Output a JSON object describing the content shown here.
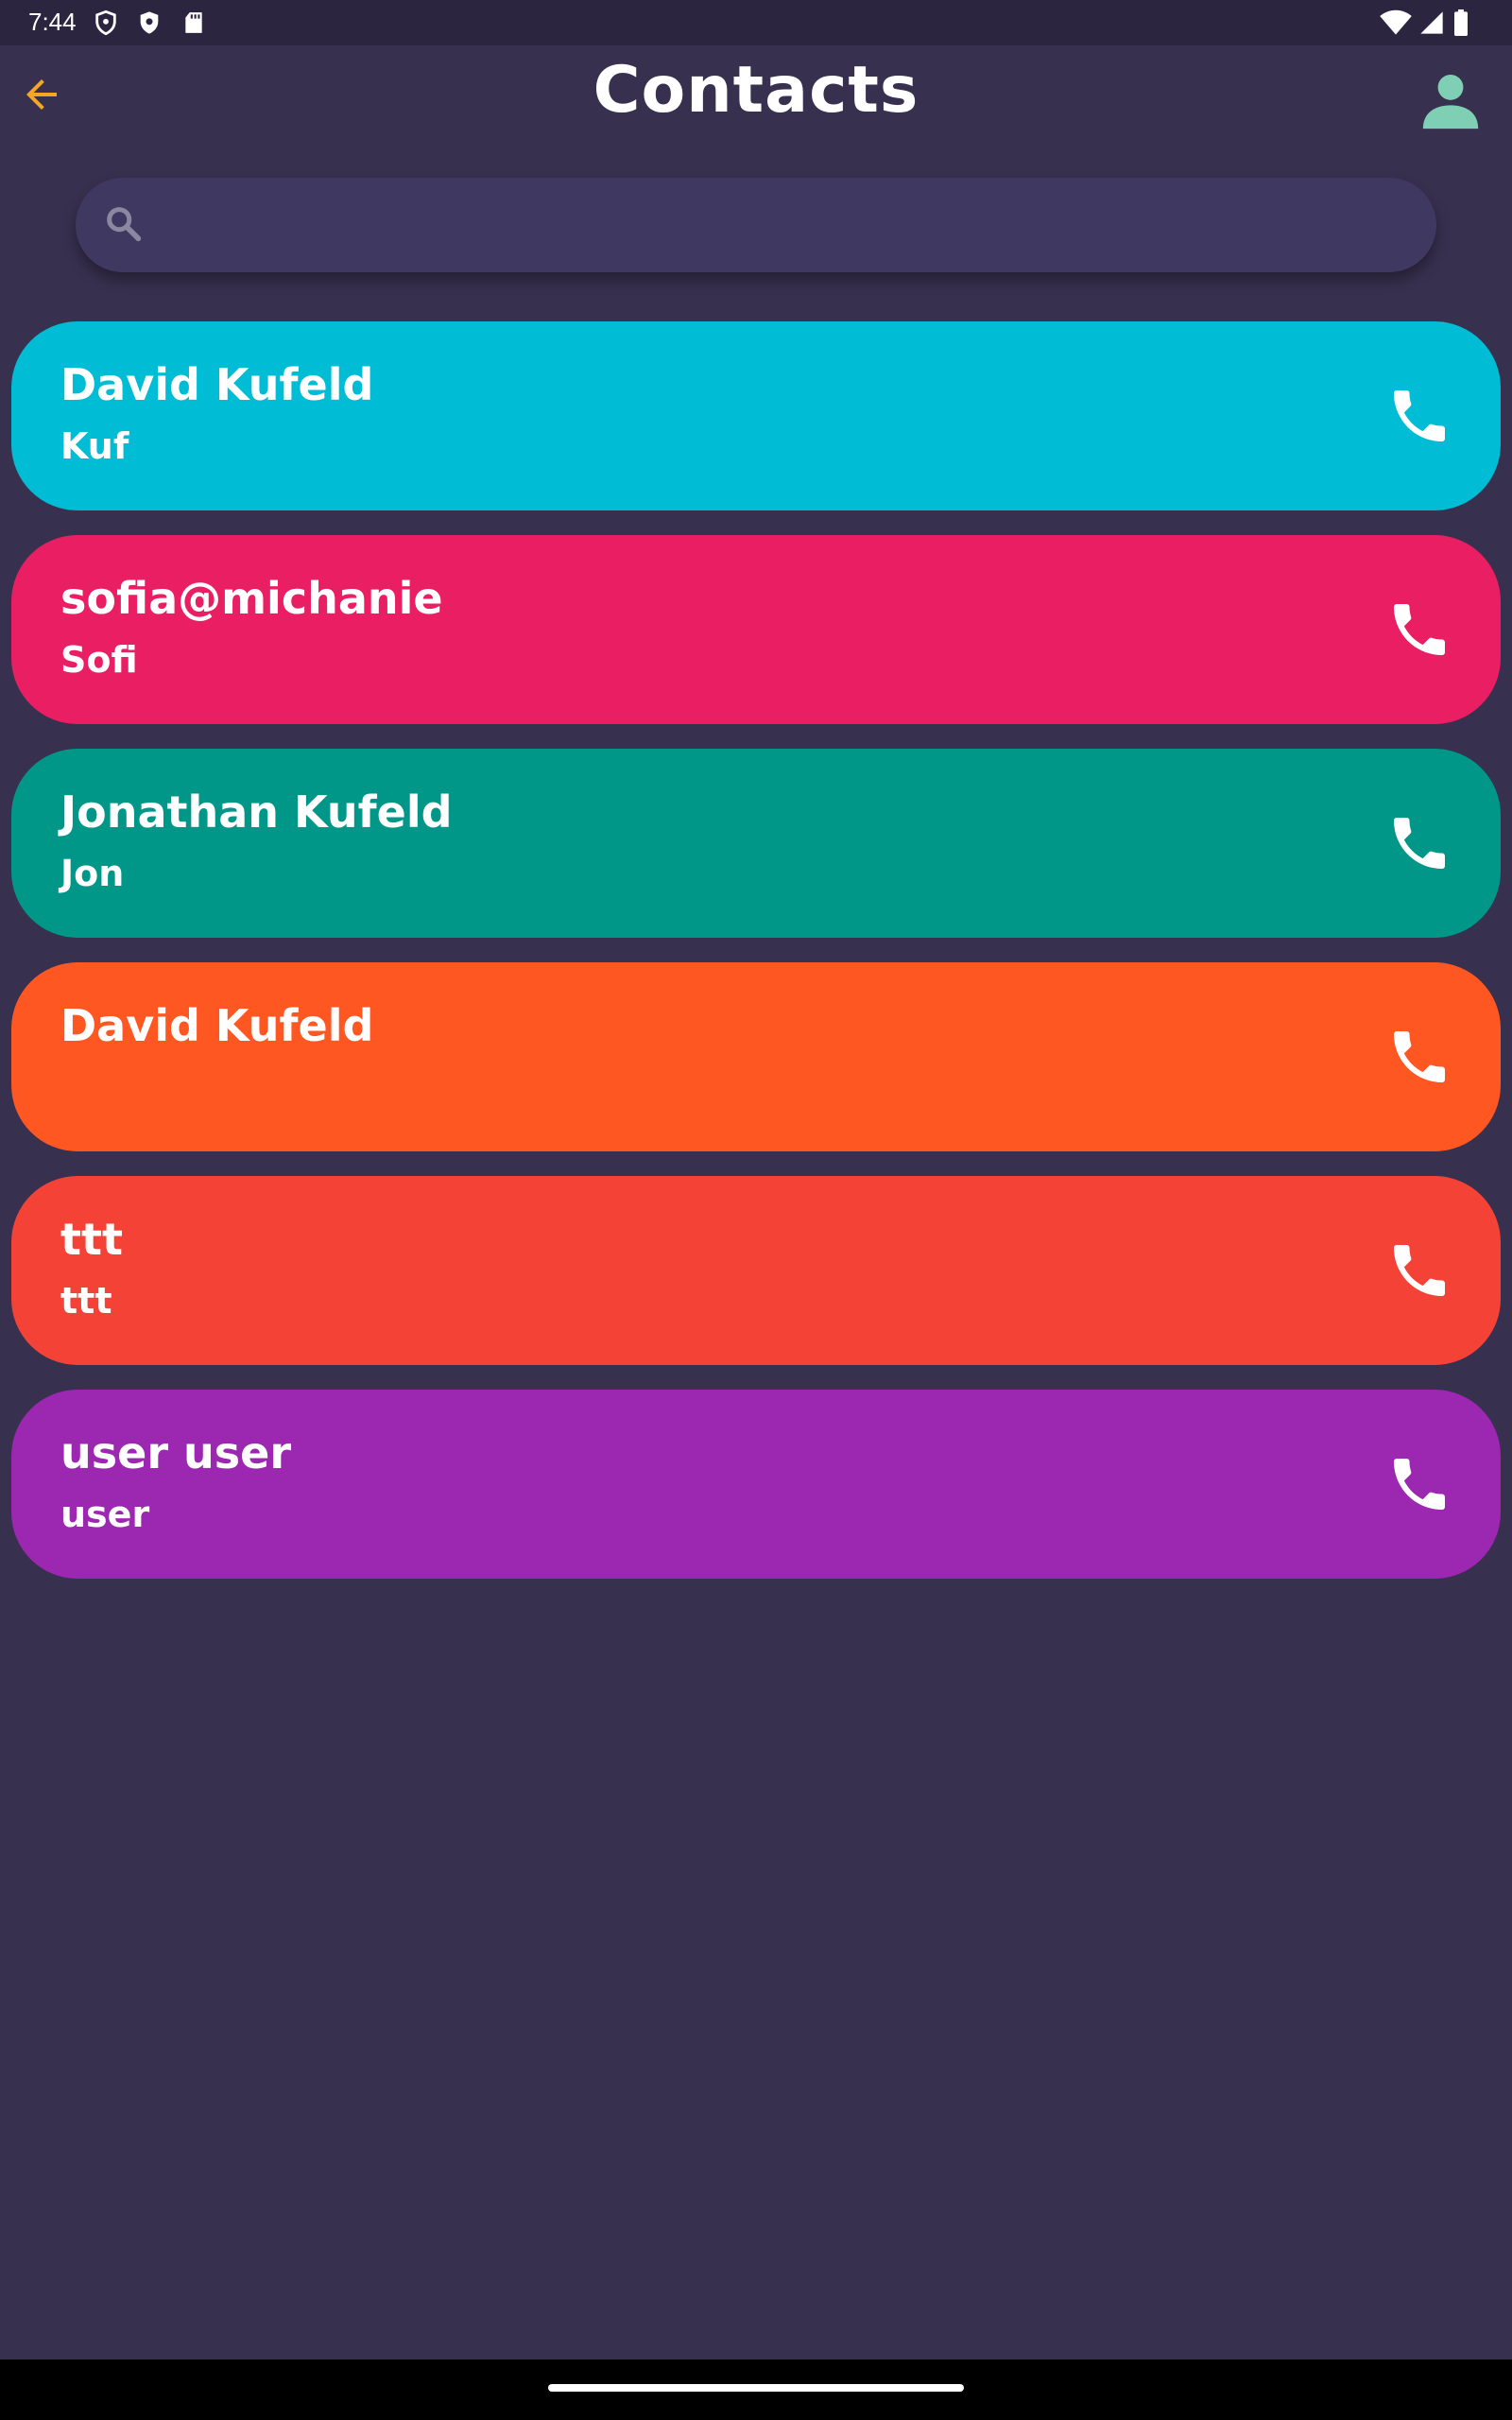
{
  "status_bar": {
    "time": "7:44",
    "left_icons": [
      "vpn-shield-icon",
      "security-shield-icon",
      "sd-card-icon"
    ],
    "right_icons": [
      "wifi-icon",
      "signal-icon",
      "battery-icon"
    ]
  },
  "header": {
    "title": "Contacts",
    "back_icon": "arrow-left-icon",
    "profile_icon": "person-icon",
    "back_color": "#f5a623",
    "profile_color": "#7fcfb5"
  },
  "search": {
    "icon": "search-icon",
    "placeholder": "",
    "value": ""
  },
  "contacts": [
    {
      "name": "David Kufeld",
      "nickname": "Kuf",
      "color": "#00bcd4",
      "icon": "phone-icon"
    },
    {
      "name": "sofia@michanie",
      "nickname": "Sofi",
      "color": "#e91e63",
      "icon": "phone-icon"
    },
    {
      "name": "Jonathan Kufeld",
      "nickname": "Jon",
      "color": "#009688",
      "icon": "phone-icon"
    },
    {
      "name": "David Kufeld",
      "nickname": "",
      "color": "#ff5722",
      "icon": "phone-icon"
    },
    {
      "name": "ttt",
      "nickname": "ttt",
      "color": "#f44336",
      "icon": "phone-icon"
    },
    {
      "name": "user user",
      "nickname": "user",
      "color": "#9c27b0",
      "icon": "phone-icon"
    }
  ],
  "colors": {
    "background": "#37304f",
    "status_bar": "#2b2540",
    "search_field": "#3f3860"
  }
}
